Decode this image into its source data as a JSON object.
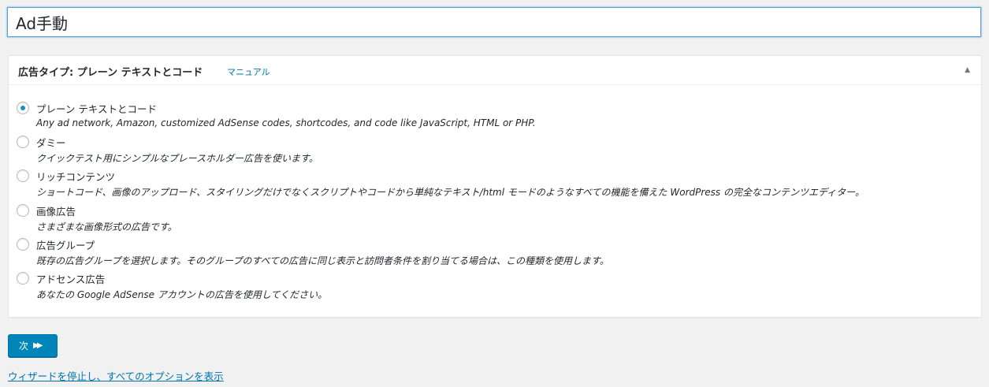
{
  "title_field": {
    "value": "Ad手動"
  },
  "postbox": {
    "title": "広告タイプ: プレーン テキストとコード",
    "manual_link": "マニュアル",
    "toggle_icon": "▲"
  },
  "ad_types": [
    {
      "label": "プレーン テキストとコード",
      "description": "Any ad network, Amazon, customized AdSense codes, shortcodes, and code like JavaScript, HTML or PHP.",
      "checked": true
    },
    {
      "label": "ダミー",
      "description": "クイックテスト用にシンプルなプレースホルダー広告を使います。",
      "checked": false
    },
    {
      "label": "リッチコンテンツ",
      "description": "ショートコード、画像のアップロード、スタイリングだけでなくスクリプトやコードから単純なテキスト/html モードのようなすべての機能を備えた WordPress の完全なコンテンツエディター。",
      "checked": false
    },
    {
      "label": "画像広告",
      "description": "さまざまな画像形式の広告です。",
      "checked": false
    },
    {
      "label": "広告グループ",
      "description": "既存の広告グループを選択します。そのグループのすべての広告に同じ表示と訪問者条件を割り当てる場合は、この種類を使用します。",
      "checked": false
    },
    {
      "label": "アドセンス広告",
      "description": "あなたの Google AdSense アカウントの広告を使用してください。",
      "checked": false
    }
  ],
  "next_button": {
    "label": "次",
    "icon": "▶▶"
  },
  "stop_wizard_link": "ウィザードを停止し、すべてのオプションを表示",
  "colors": {
    "accent": "#0085ba",
    "link": "#0073aa",
    "background": "#f1f1f1"
  }
}
